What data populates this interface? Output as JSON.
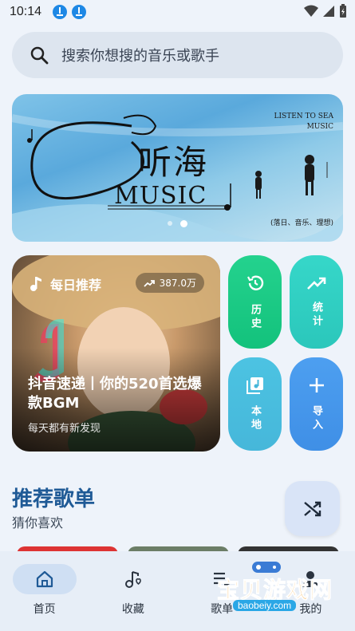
{
  "status_bar": {
    "time": "10:14"
  },
  "search": {
    "placeholder": "搜索你想搜的音乐或歌手"
  },
  "banner": {
    "title": "听海",
    "subtitle": "MUSIC",
    "corner_text_line1": "LISTEN  TO  SEA",
    "corner_text_line2": "MUSIC",
    "tags": "(落日、音乐、理想)",
    "page_count": 2,
    "active_page": 2
  },
  "daily": {
    "label": "每日推荐",
    "count": "387.0万",
    "title": "抖音速递丨你的520首选爆款BGM",
    "subtitle": "每天都有新发现"
  },
  "tiles": {
    "history": "历史",
    "stats": "统计",
    "local": "本地",
    "import": "导入"
  },
  "section": {
    "title": "推荐歌单",
    "subtitle": "猜你喜欢"
  },
  "nav": {
    "home": "首页",
    "favorites": "收藏",
    "playlists": "歌单",
    "mine": "我的"
  },
  "watermark": {
    "text": "宝贝游戏网",
    "url": "baobeiy.com"
  },
  "colors": {
    "accent": "#1f5a96",
    "history": "#1ccb85",
    "stats": "#31cfc2",
    "local": "#49bddd",
    "import": "#4697eb"
  }
}
